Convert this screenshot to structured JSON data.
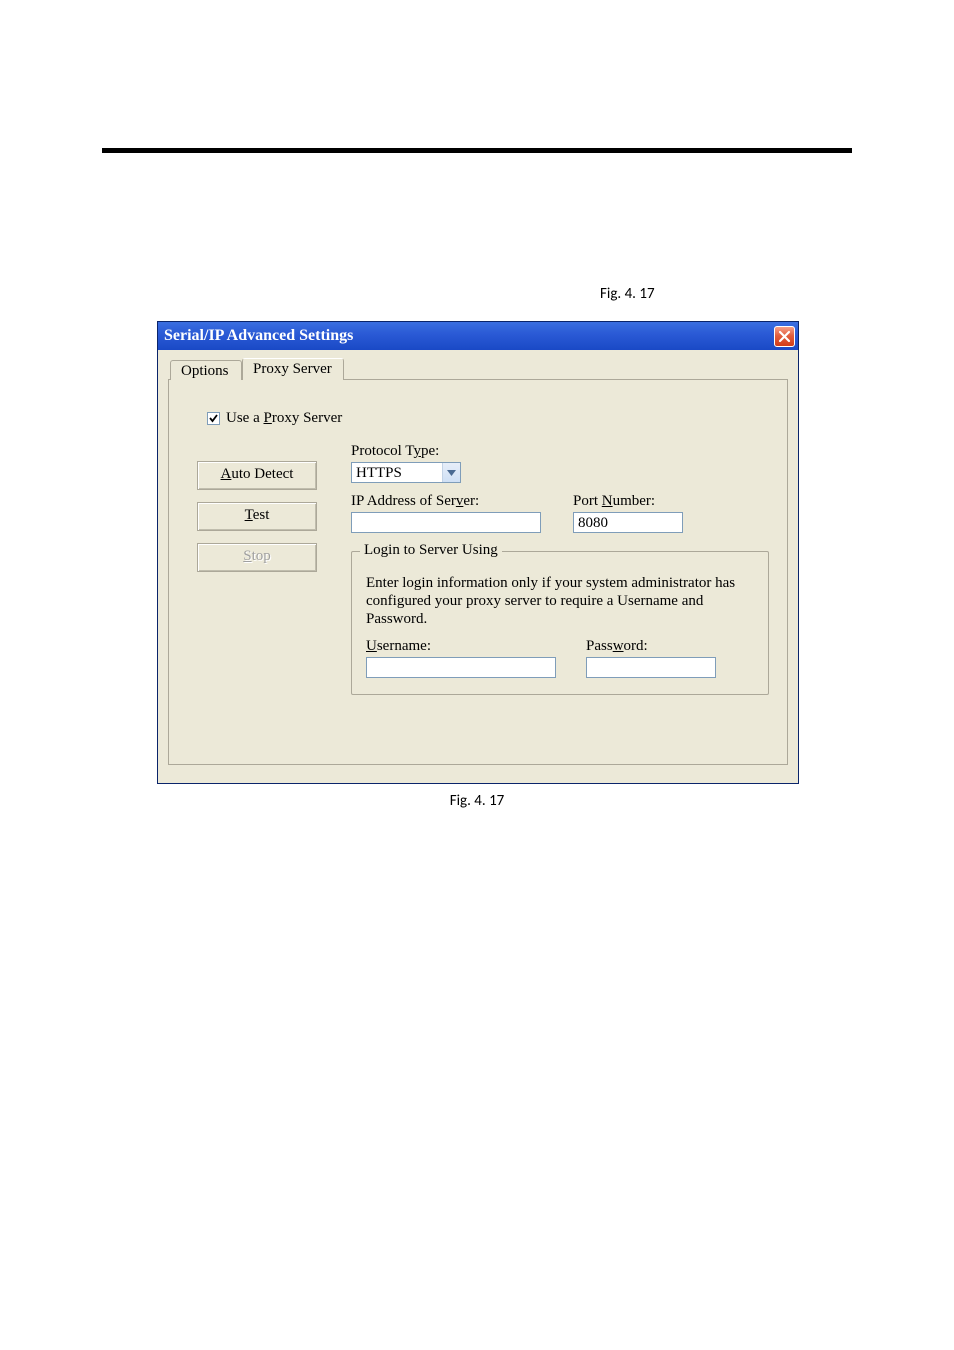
{
  "figure_label_top": "Fig. 4. 17",
  "figure_label_bottom": "Fig. 4. 17",
  "dialog": {
    "title": "Serial/IP Advanced Settings",
    "tabs": {
      "options": "Options",
      "proxy": "Proxy Server"
    },
    "checkbox_label_prefix_underlined": "P",
    "checkbox_label_before": "Use a ",
    "checkbox_label_after": "roxy Server",
    "buttons": {
      "auto_detect_underlined": "A",
      "auto_detect_rest": "uto Detect",
      "test_underlined": "T",
      "test_rest": "est",
      "stop_underlined": "S",
      "stop_rest": "top"
    },
    "protocol_label_before": "Protocol T",
    "protocol_label_underlined": "y",
    "protocol_label_after": "pe:",
    "protocol_value": "HTTPS",
    "ip_label_before": "IP Address of Ser",
    "ip_label_underlined": "v",
    "ip_label_after": "er:",
    "ip_value": "",
    "port_label_before": "Port ",
    "port_label_underlined": "N",
    "port_label_after": "umber:",
    "port_value": "8080",
    "group_legend": "Login to Server Using",
    "group_desc": "Enter login information only if your system administrator has configured your proxy server to require a Username and Password.",
    "username_label_underlined": "U",
    "username_label_rest": "sername:",
    "username_value": "",
    "password_label_before": "Pass",
    "password_label_underlined": "w",
    "password_label_after": "ord:",
    "password_value": ""
  }
}
